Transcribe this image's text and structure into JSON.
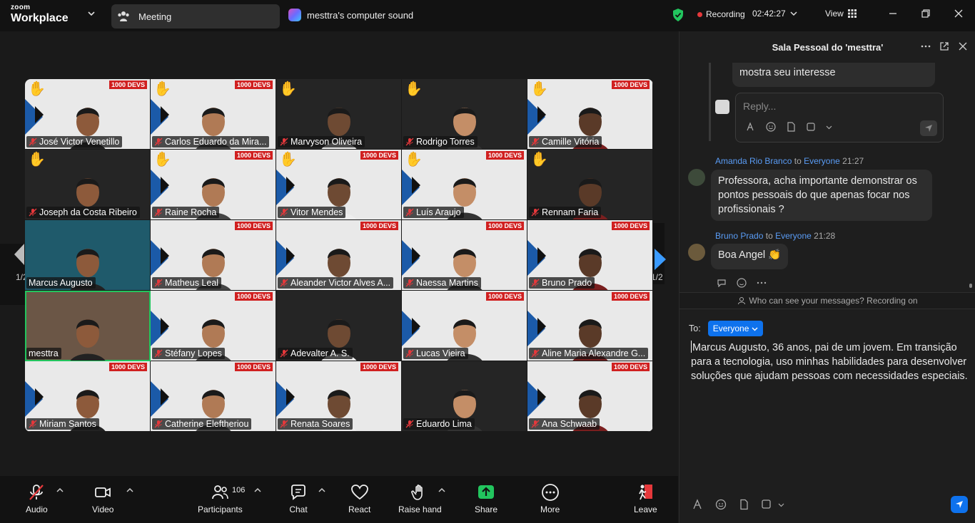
{
  "titlebar": {
    "logo_small": "zoom",
    "logo_big": "Workplace",
    "meeting_tab": "Meeting",
    "sound_tab": "mesttra's computer sound",
    "recording": "Recording",
    "timer": "02:42:27",
    "view": "View"
  },
  "video": {
    "page_left": "1/2",
    "page_right": "1/2",
    "banner": "1000 DEVS",
    "participants": [
      {
        "name": "José Victor Venetillo",
        "muted": true,
        "hand": true,
        "bg": "light"
      },
      {
        "name": "Carlos Eduardo da Mira...",
        "muted": true,
        "hand": true,
        "bg": "light"
      },
      {
        "name": "Marvyson Oliveira",
        "muted": true,
        "hand": true,
        "bg": "dark"
      },
      {
        "name": "Rodrigo Torres",
        "muted": true,
        "hand": true,
        "bg": "dark"
      },
      {
        "name": "Camille Vitória",
        "muted": true,
        "hand": true,
        "bg": "light"
      },
      {
        "name": "Joseph da Costa Ribeiro",
        "muted": true,
        "hand": true,
        "bg": "dark"
      },
      {
        "name": "Raine Rocha",
        "muted": true,
        "hand": true,
        "bg": "light"
      },
      {
        "name": "Vitor Mendes",
        "muted": true,
        "hand": true,
        "bg": "light"
      },
      {
        "name": "Luís Araujo",
        "muted": true,
        "hand": true,
        "bg": "light"
      },
      {
        "name": "Rennam Faria",
        "muted": true,
        "hand": true,
        "bg": "dark"
      },
      {
        "name": "Marcus Augusto",
        "muted": false,
        "hand": false,
        "bg": "teal"
      },
      {
        "name": "Matheus Leal",
        "muted": true,
        "hand": false,
        "bg": "light"
      },
      {
        "name": "Aleander Victor Alves A...",
        "muted": true,
        "hand": false,
        "bg": "light"
      },
      {
        "name": "Naessa Martins",
        "muted": true,
        "hand": false,
        "bg": "light"
      },
      {
        "name": "Bruno Prado",
        "muted": true,
        "hand": false,
        "bg": "light"
      },
      {
        "name": "mesttra",
        "muted": false,
        "hand": false,
        "bg": "room",
        "active": true
      },
      {
        "name": "Stéfany Lopes",
        "muted": true,
        "hand": false,
        "bg": "light"
      },
      {
        "name": "Adevalter A. S.",
        "muted": true,
        "hand": false,
        "bg": "dark"
      },
      {
        "name": "Lucas Vieira",
        "muted": true,
        "hand": false,
        "bg": "light"
      },
      {
        "name": "Aline Maria Alexandre G...",
        "muted": true,
        "hand": false,
        "bg": "light"
      },
      {
        "name": "Miriam Santos",
        "muted": true,
        "hand": false,
        "bg": "light"
      },
      {
        "name": "Catherine Eleftheriou",
        "muted": true,
        "hand": false,
        "bg": "light"
      },
      {
        "name": "Renata Soares",
        "muted": true,
        "hand": false,
        "bg": "light"
      },
      {
        "name": "Eduardo Lima",
        "muted": true,
        "hand": false,
        "bg": "dark"
      },
      {
        "name": "Ana Schwaab",
        "muted": true,
        "hand": false,
        "bg": "light"
      }
    ]
  },
  "toolbar": {
    "audio": "Audio",
    "video": "Video",
    "participants": "Participants",
    "participants_count": "106",
    "chat": "Chat",
    "react": "React",
    "raise_hand": "Raise hand",
    "share": "Share",
    "more": "More",
    "leave": "Leave"
  },
  "chat": {
    "title": "Sala Pessoal do 'mesttra'",
    "prev_message_line": "mostra seu interesse",
    "reply_placeholder": "Reply...",
    "msg1": {
      "sender": "Amanda Rio Branco",
      "to_word": "to",
      "to": "Everyone",
      "time": "21:27",
      "text": "Professora, acha importante demonstrar os pontos pessoais do que apenas focar nos profissionais ?"
    },
    "msg2": {
      "sender": "Bruno Prado",
      "to_word": "to",
      "to": "Everyone",
      "time": "21:28",
      "text": "Boa Angel 👏"
    },
    "notice": "Who can see your messages? Recording on",
    "to_label": "To:",
    "to_value": "Everyone",
    "compose_text": "Marcus Augusto, 36 anos, pai de um jovem. Em transição para a tecnologia, uso minhas habilidades para desenvolver soluções que ajudam pessoas com necessidades especiais."
  },
  "colors": {
    "accent": "#0e72ed",
    "share_green": "#22c55e",
    "record_red": "#e5383b",
    "leave_red": "#e5383b",
    "link_blue": "#5a9cf5"
  }
}
